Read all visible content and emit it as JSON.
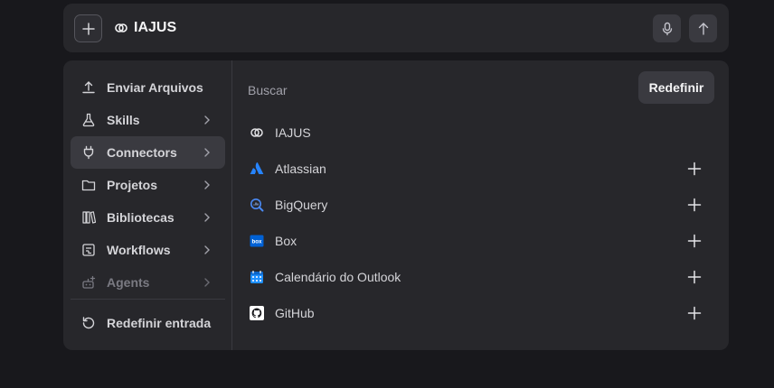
{
  "topbar": {
    "context_label": "IAJUS"
  },
  "menu": {
    "items": [
      {
        "label": "Enviar Arquivos",
        "icon": "upload-icon",
        "has_submenu": false
      },
      {
        "label": "Skills",
        "icon": "flask-icon",
        "has_submenu": true
      },
      {
        "label": "Connectors",
        "icon": "plug-icon",
        "has_submenu": true,
        "active": true
      },
      {
        "label": "Projetos",
        "icon": "folder-icon",
        "has_submenu": true
      },
      {
        "label": "Bibliotecas",
        "icon": "library-icon",
        "has_submenu": true
      },
      {
        "label": "Workflows",
        "icon": "workflow-icon",
        "has_submenu": true
      },
      {
        "label": "Agents",
        "icon": "agent-icon",
        "has_submenu": true,
        "disabled": true
      }
    ],
    "reset_entry_label": "Redefinir entrada"
  },
  "connectors": {
    "search_label": "Buscar",
    "reset_button_label": "Redefinir",
    "items": [
      {
        "label": "IAJUS",
        "icon": "iajus-logo-icon",
        "addable": false
      },
      {
        "label": "Atlassian",
        "icon": "atlassian-logo-icon",
        "addable": true
      },
      {
        "label": "BigQuery",
        "icon": "bigquery-logo-icon",
        "addable": true
      },
      {
        "label": "Box",
        "icon": "box-logo-icon",
        "addable": true
      },
      {
        "label": "Calendário do Outlook",
        "icon": "outlook-calendar-icon",
        "addable": true
      },
      {
        "label": "GitHub",
        "icon": "github-logo-icon",
        "addable": true
      }
    ]
  },
  "colors": {
    "background": "#18181c",
    "surface": "#27272b",
    "active_item": "#3a3a40",
    "atlassian_blue": "#2684ff",
    "box_blue": "#0061d5",
    "bigquery_blue": "#4a8af4"
  }
}
